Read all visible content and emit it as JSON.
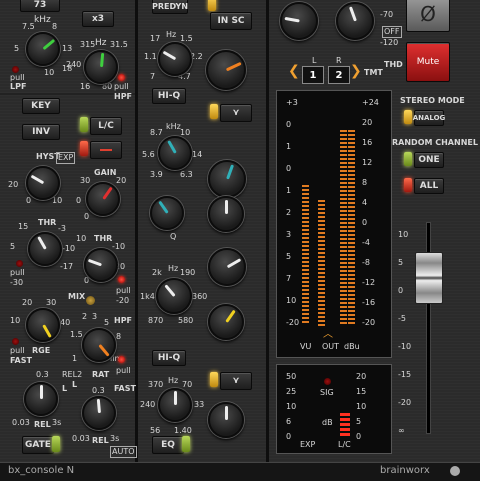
{
  "eq_section": {
    "top_value": "73",
    "x3_button": "x3",
    "lpf": {
      "unit": "kHz",
      "ticks": [
        "7.5",
        "8",
        "13",
        "5",
        "18",
        "10"
      ],
      "pull_label": "pull",
      "name": "LPF"
    },
    "hpf": {
      "unit": "Hz",
      "ticks": [
        "315",
        "31.5",
        "240",
        "16",
        "80"
      ],
      "pull_label": "pull",
      "name": "HPF"
    }
  },
  "dyn_section": {
    "key_button": "KEY",
    "inv_button": "INV",
    "lc_button": "L/C",
    "exp_badge": "EXP",
    "hyst": {
      "label": "HYST",
      "ticks": [
        "20",
        "0",
        "10"
      ]
    },
    "gain": {
      "label": "GAIN",
      "ticks": [
        "30",
        "20",
        "0",
        "0"
      ]
    },
    "thr_gate": {
      "label": "THR",
      "ticks": [
        "15",
        "-3",
        "5",
        "-10",
        "-17"
      ],
      "pull_label": "pull",
      "value": "-30"
    },
    "thr_comp": {
      "label": "THR",
      "ticks": [
        "10",
        "-10",
        "0",
        "-20"
      ],
      "pull_label": "pull",
      "value": "-20"
    },
    "mix": {
      "label": "MIX"
    },
    "range": {
      "label": "RGE",
      "ticks": [
        "20",
        "30",
        "10",
        "40"
      ],
      "pull_label": "pull",
      "fast": "FAST"
    },
    "ratio": {
      "label": "RAT",
      "ticks": [
        "2",
        "3",
        "5",
        "1.5",
        "8",
        "1",
        "lim"
      ],
      "pull_label": "pull",
      "fast": "FAST"
    },
    "rel_gate": {
      "label": "REL",
      "ticks": [
        "0.3",
        "0.03",
        "3s"
      ],
      "side": "L"
    },
    "rel_comp": {
      "label": "REL",
      "ticks": [
        "REL2",
        "0.3",
        "0.03",
        "3s"
      ],
      "side": "L",
      "auto": "AUTO"
    },
    "gate_button": "GATE",
    "hpf_label": "HPF"
  },
  "peq_section": {
    "predyn": "PREDYN",
    "in_sc": "IN SC",
    "hi_q_top": "HI-Q",
    "hi_q_bottom": "HI-Q",
    "eq_button": "EQ",
    "band1": {
      "unit": "Hz",
      "ticks": [
        "17",
        "1.5",
        "1.1",
        "2.2",
        "7",
        "4.7"
      ]
    },
    "band2": {
      "unit": "kHz",
      "ticks": [
        "8.7",
        "10",
        "14",
        "5.6",
        "6.3",
        "3.9"
      ],
      "q": "Q"
    },
    "band3": {
      "unit": "Hz",
      "ticks": [
        "2k",
        "190",
        "1k4",
        "360",
        "870",
        "580"
      ],
      "q": "Q"
    },
    "band4": {
      "unit": "Hz",
      "ticks": [
        "370",
        "70",
        "33",
        "240",
        "56",
        "1.40"
      ]
    }
  },
  "out_section": {
    "channel_labels": [
      "L",
      "R"
    ],
    "badges": [
      "1",
      "2"
    ],
    "tmt": "TMT",
    "thd": "THD",
    "off": "OFF",
    "knob_ticks": [
      "-70",
      "-120"
    ],
    "phase_symbol": "Ø",
    "mute": "Mute",
    "vu_scale": [
      "+3",
      "0",
      "1",
      "0",
      "1",
      "2",
      "3",
      "5",
      "7",
      "10",
      "-20"
    ],
    "dbu_scale": [
      "+24",
      "20",
      "16",
      "12",
      "8",
      "4",
      "0",
      "-4",
      "-8",
      "-12",
      "-16",
      "-20"
    ],
    "meter_labels": [
      "VU",
      "OUT",
      "dBu"
    ],
    "stereo_mode": "STEREO MODE",
    "analog": "ANALOG",
    "random_channel": "RANDOM CHANNEL",
    "one": "ONE",
    "all": "ALL",
    "fader_scale": [
      "10",
      "5",
      "0",
      "-5",
      "-10",
      "-15",
      "-20",
      "∞"
    ],
    "sig": "SIG",
    "exp_scale": [
      "50",
      "25",
      "10",
      "6",
      "0"
    ],
    "lc_scale": [
      "20",
      "15",
      "10",
      "5",
      "0"
    ],
    "db": "dB",
    "exp": "EXP",
    "lc": "L/C"
  },
  "footer": {
    "product": "bx_console N",
    "brand": "brainworx"
  },
  "colors": {
    "accent_green": "#3fcf3f",
    "accent_red": "#e03030",
    "accent_orange": "#f08020",
    "accent_yellow": "#f0d020",
    "accent_teal": "#30b0b8",
    "led_green": "#b8d85a",
    "led_yellow": "#ffd85a",
    "meter_orange": "#e07a20"
  }
}
